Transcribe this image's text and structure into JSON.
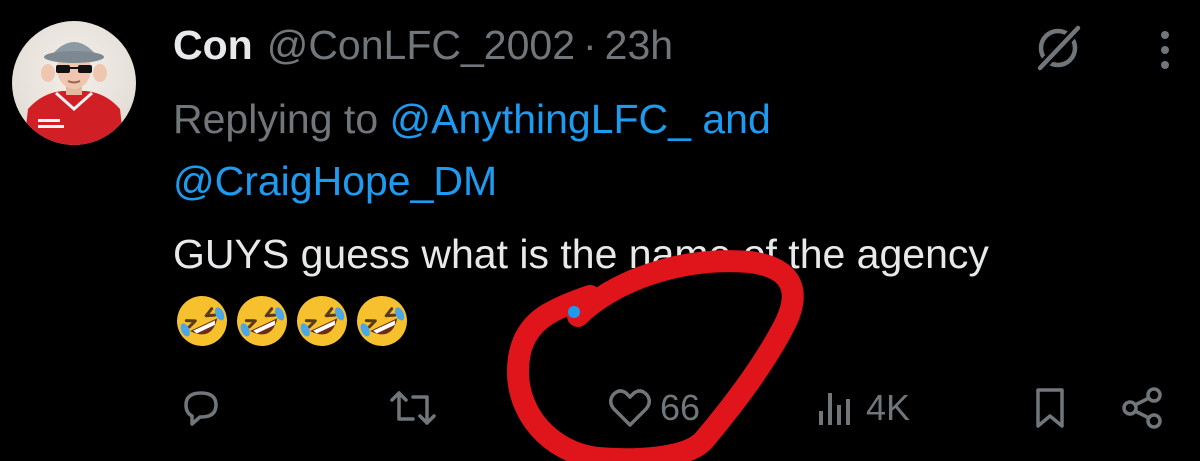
{
  "tweet": {
    "display_name": "Con",
    "handle": "@ConLFC_2002",
    "separator": "·",
    "time": "23h",
    "reply_prefix": "Replying to",
    "reply_mention_1": "@AnythingLFC_",
    "reply_and": "and",
    "reply_mention_2": "@CraigHope_DM",
    "text": "GUYS guess what is the name of the agency",
    "emoji_count": 4
  },
  "actions": {
    "reply_count": "",
    "retweet_count": "",
    "like_count": "66",
    "views_count": "4K"
  },
  "colors": {
    "background": "#000000",
    "text_primary": "#e7e9ea",
    "text_secondary": "#71767b",
    "link": "#1d9bf0",
    "annotation": "#e0151b"
  },
  "icons": {
    "header": [
      "grok-icon",
      "more-icon"
    ],
    "actions": [
      "reply-icon",
      "retweet-icon",
      "like-icon",
      "views-icon",
      "bookmark-icon",
      "share-icon"
    ]
  }
}
